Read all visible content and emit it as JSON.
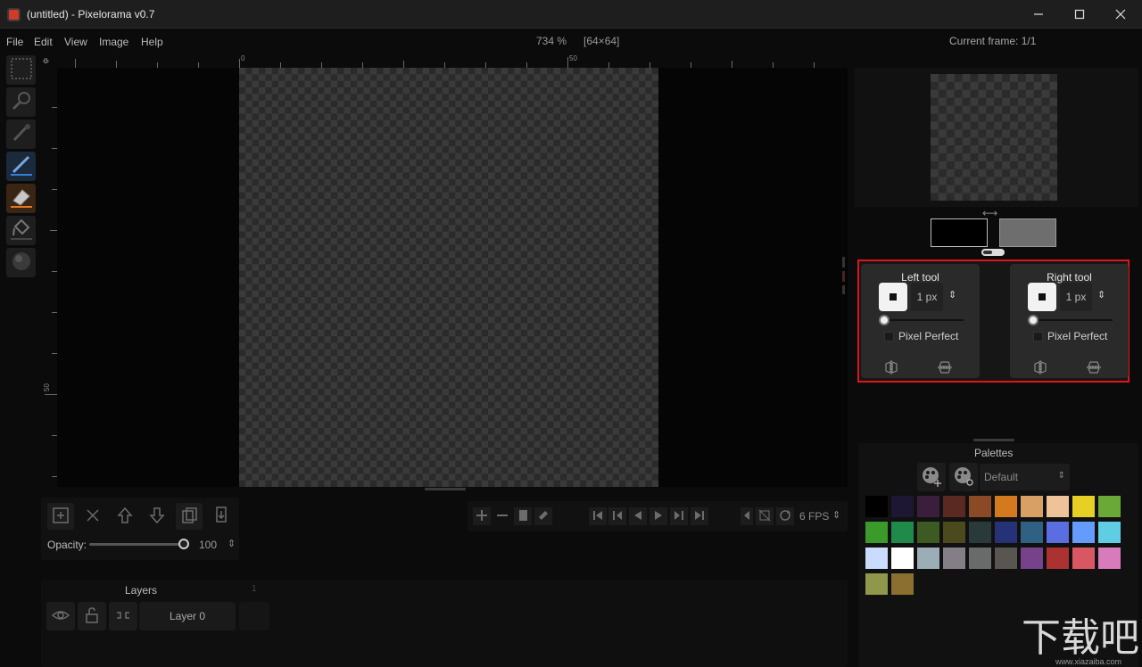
{
  "window": {
    "title": "(untitled) - Pixelorama v0.7",
    "controls": [
      "minimize-icon",
      "maximize-icon",
      "close-icon"
    ]
  },
  "menu": {
    "items": [
      "File",
      "Edit",
      "View",
      "Image",
      "Help"
    ]
  },
  "status": {
    "zoom": "734 %",
    "size": "[64×64]",
    "current_frame": "Current frame: 1/1"
  },
  "tools": [
    {
      "name": "rect-select-icon",
      "active": false
    },
    {
      "name": "zoom-icon",
      "active": false
    },
    {
      "name": "color-picker-icon",
      "active": false
    },
    {
      "name": "pencil-icon",
      "active": true,
      "accent": "#3a7bd5"
    },
    {
      "name": "eraser-icon",
      "active": true,
      "accent": "#e07a1f"
    },
    {
      "name": "bucket-icon",
      "active": false
    },
    {
      "name": "shading-icon",
      "active": false
    }
  ],
  "ruler": {
    "top_labels": [
      "0",
      "0",
      "50"
    ],
    "left_labels": [
      "0",
      "50"
    ]
  },
  "layers": {
    "opacity_label": "Opacity:",
    "opacity_value": "100",
    "opacity_fraction": 1.0,
    "title": "Layers",
    "frame_number": "1",
    "items": [
      {
        "name": "Layer 0"
      }
    ]
  },
  "timeline": {
    "fps": "6 FPS"
  },
  "colors": {
    "left": "#000000",
    "right": "#6e6e6e"
  },
  "left_tool": {
    "title": "Left tool",
    "size": "1 px",
    "pixel_perfect_label": "Pixel Perfect",
    "pixel_perfect": false
  },
  "right_tool": {
    "title": "Right tool",
    "size": "1 px",
    "pixel_perfect_label": "Pixel Perfect",
    "pixel_perfect": false
  },
  "palettes": {
    "title": "Palettes",
    "selected": "Default",
    "swatches": [
      "#000000",
      "#1d1733",
      "#3a1f3c",
      "#5a2a22",
      "#8a4a26",
      "#d47a1e",
      "#d9a066",
      "#eec39a",
      "#e6d023",
      "#6aa938",
      "#3a9a2a",
      "#1f8a4a",
      "#3d5a22",
      "#4b4a1e",
      "#2a3a3a",
      "#253277",
      "#306082",
      "#5b6ee1",
      "#639bff",
      "#5fcde4",
      "#cbdbfc",
      "#ffffff",
      "#9badb7",
      "#847e87",
      "#696a6a",
      "#595652",
      "#76428a",
      "#ac3232",
      "#d95763",
      "#d77bba",
      "#8f974a",
      "#8a6f30"
    ]
  },
  "watermark": {
    "text": "下载吧",
    "url": "www.xiazaiba.com"
  }
}
